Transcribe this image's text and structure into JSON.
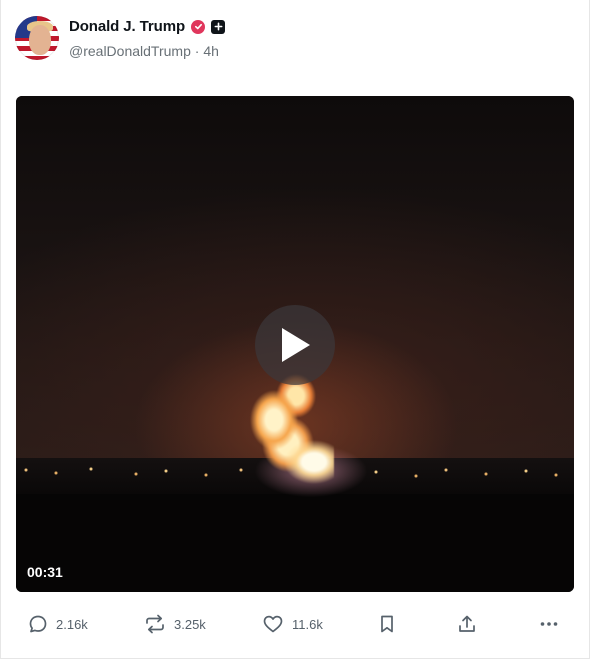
{
  "post": {
    "author": {
      "display_name": "Donald J. Trump",
      "handle": "@realDonaldTrump",
      "separator": "·",
      "time_ago": "4h"
    },
    "video": {
      "duration": "00:31"
    },
    "actions": {
      "replies": "2.16k",
      "reposts": "3.25k",
      "likes": "11.6k"
    }
  },
  "icons": {
    "verified": "verified-check-icon",
    "plus": "plus-icon",
    "play": "play-icon",
    "reply": "reply-bubble-icon",
    "repost": "repost-icon",
    "like": "heart-icon",
    "bookmark": "bookmark-icon",
    "share": "share-upload-icon",
    "more": "more-horizontal-icon"
  },
  "colors": {
    "verified_badge": "#e0365c",
    "text_secondary": "#687076",
    "action_icon": "#56616b"
  }
}
